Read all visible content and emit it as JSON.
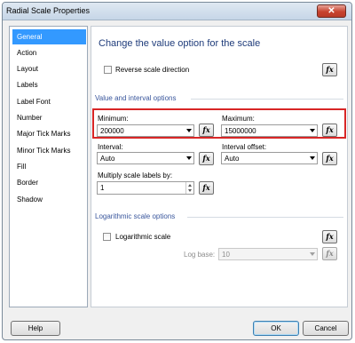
{
  "window": {
    "title": "Radial Scale Properties",
    "close_label": "✕"
  },
  "sidebar": {
    "items": [
      {
        "label": "General",
        "selected": true
      },
      {
        "label": "Action"
      },
      {
        "label": "Layout"
      },
      {
        "label": "Labels"
      },
      {
        "label": "Label Font"
      },
      {
        "label": "Number"
      },
      {
        "label": "Major Tick Marks"
      },
      {
        "label": "Minor Tick Marks"
      },
      {
        "label": "Fill"
      },
      {
        "label": "Border"
      },
      {
        "label": "Shadow"
      }
    ]
  },
  "general": {
    "heading": "Change the value option for the scale",
    "reverse_label": "Reverse scale direction",
    "value_section": "Value and interval options",
    "minimum_label": "Minimum:",
    "minimum_value": "200000",
    "maximum_label": "Maximum:",
    "maximum_value": "15000000",
    "interval_label": "Interval:",
    "interval_value": "Auto",
    "interval_offset_label": "Interval offset:",
    "interval_offset_value": "Auto",
    "multiply_label": "Multiply scale labels by:",
    "multiply_value": "1",
    "log_section": "Logarithmic scale options",
    "log_label": "Logarithmic scale",
    "log_base_label": "Log base:",
    "log_base_value": "10",
    "fx_label": "fx"
  },
  "footer": {
    "help": "Help",
    "ok": "OK",
    "cancel": "Cancel"
  },
  "colors": {
    "selection": "#3399ff",
    "highlight": "#d82626",
    "heading": "#1e3b7a",
    "section": "#39569c"
  }
}
